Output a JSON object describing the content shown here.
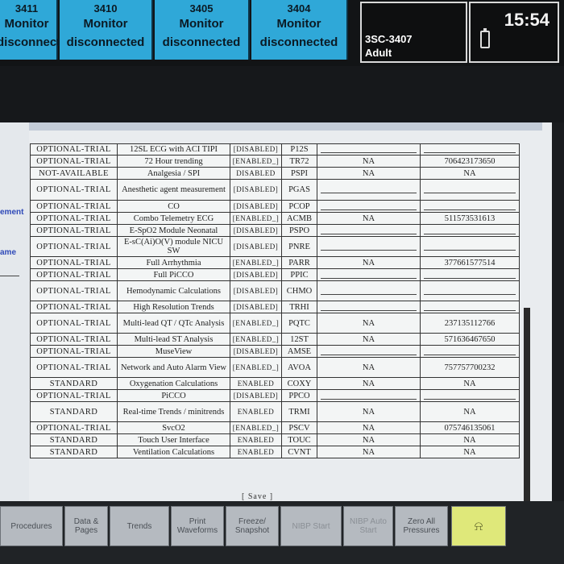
{
  "beds": [
    {
      "number": "3411",
      "line1": "Monitor",
      "line2": "disconnected"
    },
    {
      "number": "3410",
      "line1": "Monitor",
      "line2": "disconnected"
    },
    {
      "number": "3405",
      "line1": "Monitor",
      "line2": "disconnected"
    },
    {
      "number": "3404",
      "line1": "Monitor",
      "line2": "disconnected"
    }
  ],
  "patient": {
    "bed": "3SC-3407",
    "category": "Adult"
  },
  "clock": "15:54",
  "side_labels": [
    "ement",
    "ame"
  ],
  "options": [
    {
      "status": "OPTIONAL-TRIAL",
      "name": "12SL ECG with ACI TIPI",
      "enabled": "[DISABLED]",
      "code": "P12S",
      "c5": "",
      "c6": ""
    },
    {
      "status": "OPTIONAL-TRIAL",
      "name": "72 Hour trending",
      "enabled": "[ENABLED_]",
      "code": "TR72",
      "c5": "NA",
      "c6": "706423173650"
    },
    {
      "status": "NOT-AVAILABLE",
      "name": "Analgesia / SPI",
      "enabled": "DISABLED",
      "code": "PSPI",
      "c5": "NA",
      "c6": "NA"
    },
    {
      "status": "OPTIONAL-TRIAL",
      "name": "Anesthetic agent measurement",
      "enabled": "[DISABLED]",
      "code": "PGAS",
      "c5": "",
      "c6": ""
    },
    {
      "status": "OPTIONAL-TRIAL",
      "name": "CO",
      "enabled": "[DISABLED]",
      "code": "PCOP",
      "c5": "",
      "c6": ""
    },
    {
      "status": "OPTIONAL-TRIAL",
      "name": "Combo Telemetry ECG",
      "enabled": "[ENABLED_]",
      "code": "ACMB",
      "c5": "NA",
      "c6": "511573531613"
    },
    {
      "status": "OPTIONAL-TRIAL",
      "name": "E-SpO2 Module Neonatal",
      "enabled": "[DISABLED]",
      "code": "PSPO",
      "c5": "",
      "c6": ""
    },
    {
      "status": "OPTIONAL-TRIAL",
      "name": "E-sC(Ai)O(V) module NICU SW",
      "enabled": "[DISABLED]",
      "code": "PNRE",
      "c5": "",
      "c6": ""
    },
    {
      "status": "OPTIONAL-TRIAL",
      "name": "Full Arrhythmia",
      "enabled": "[ENABLED_]",
      "code": "PARR",
      "c5": "NA",
      "c6": "377661577514"
    },
    {
      "status": "OPTIONAL-TRIAL",
      "name": "Full PiCCO",
      "enabled": "[DISABLED]",
      "code": "PPIC",
      "c5": "",
      "c6": ""
    },
    {
      "status": "OPTIONAL-TRIAL",
      "name": "Hemodynamic Calculations",
      "enabled": "[DISABLED]",
      "code": "CHMO",
      "c5": "",
      "c6": ""
    },
    {
      "status": "OPTIONAL-TRIAL",
      "name": "High Resolution Trends",
      "enabled": "[DISABLED]",
      "code": "TRHI",
      "c5": "",
      "c6": ""
    },
    {
      "status": "OPTIONAL-TRIAL",
      "name": "Multi-lead QT / QTc Analysis",
      "enabled": "[ENABLED_]",
      "code": "PQTC",
      "c5": "NA",
      "c6": "237135112766"
    },
    {
      "status": "OPTIONAL-TRIAL",
      "name": "Multi-lead ST Analysis",
      "enabled": "[ENABLED_]",
      "code": "12ST",
      "c5": "NA",
      "c6": "571636467650"
    },
    {
      "status": "OPTIONAL-TRIAL",
      "name": "MuseView",
      "enabled": "[DISABLED]",
      "code": "AMSE",
      "c5": "",
      "c6": ""
    },
    {
      "status": "OPTIONAL-TRIAL",
      "name": "Network and Auto Alarm View",
      "enabled": "[ENABLED_]",
      "code": "AVOA",
      "c5": "NA",
      "c6": "757757700232"
    },
    {
      "status": "STANDARD",
      "name": "Oxygenation Calculations",
      "enabled": "ENABLED",
      "code": "COXY",
      "c5": "NA",
      "c6": "NA"
    },
    {
      "status": "OPTIONAL-TRIAL",
      "name": "PiCCO",
      "enabled": "[DISABLED]",
      "code": "PPCO",
      "c5": "",
      "c6": ""
    },
    {
      "status": "STANDARD",
      "name": "Real-time Trends / minitrends",
      "enabled": "ENABLED",
      "code": "TRMI",
      "c5": "NA",
      "c6": "NA"
    },
    {
      "status": "OPTIONAL-TRIAL",
      "name": "SvcO2",
      "enabled": "[ENABLED_]",
      "code": "PSCV",
      "c5": "NA",
      "c6": "075746135061"
    },
    {
      "status": "STANDARD",
      "name": "Touch User Interface",
      "enabled": "ENABLED",
      "code": "TOUC",
      "c5": "NA",
      "c6": "NA"
    },
    {
      "status": "STANDARD",
      "name": "Ventilation Calculations",
      "enabled": "ENABLED",
      "code": "CVNT",
      "c5": "NA",
      "c6": "NA"
    }
  ],
  "save_label": "[ Save ]",
  "softkeys": [
    {
      "label": "Procedures",
      "dim": false
    },
    {
      "label": "Data & Pages",
      "dim": false
    },
    {
      "label": "Trends",
      "dim": false
    },
    {
      "label": "Print Waveforms",
      "dim": false
    },
    {
      "label": "Freeze/ Snapshot",
      "dim": false
    },
    {
      "label": "NIBP Start",
      "dim": true
    },
    {
      "label": "NIBP Auto Start",
      "dim": true
    },
    {
      "label": "Zero All Pressures",
      "dim": false
    }
  ],
  "alarm_icon": "alarm-bell-icon",
  "colors": {
    "bed_tile": "#2fa8d8",
    "alarm_key": "#dfe87a",
    "side_label": "#2e49b8"
  }
}
